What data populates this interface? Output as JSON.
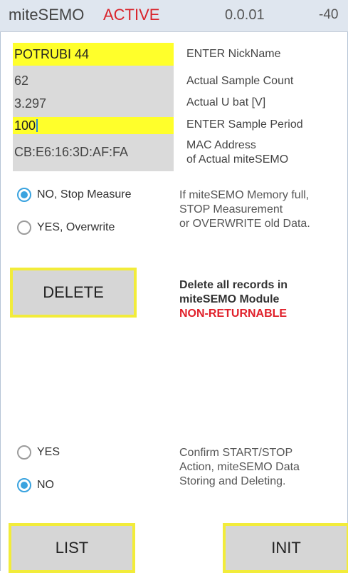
{
  "header": {
    "app_name": "miteSEMO",
    "status": "ACTIVE",
    "version": "0.0.01",
    "signal": "-40"
  },
  "fields": {
    "nickname": {
      "value": "POTRUBI 44",
      "label": "ENTER NickName"
    },
    "sample_count": {
      "value": "62",
      "label": "Actual Sample Count"
    },
    "u_bat": {
      "value": "3.297",
      "label": "Actual U bat [V]"
    },
    "sample_period": {
      "value": "100",
      "label": "ENTER Sample Period"
    },
    "mac": {
      "value": "CB:E6:16:3D:AF:FA",
      "label_line1": "MAC Address",
      "label_line2": "of Actual miteSEMO"
    }
  },
  "memory_full": {
    "options": [
      {
        "label": "NO, Stop Measure",
        "selected": true
      },
      {
        "label": "YES, Overwrite",
        "selected": false
      }
    ],
    "info_line1": "If miteSEMO Memory full,",
    "info_line2": "STOP Measurement",
    "info_line3": "or OVERWRITE old Data."
  },
  "delete": {
    "button_label": "DELETE",
    "info_line1": "Delete all records in",
    "info_line2": "miteSEMO Module",
    "warning": "NON-RETURNABLE"
  },
  "confirm": {
    "options": [
      {
        "label": "YES",
        "selected": false
      },
      {
        "label": "NO",
        "selected": true
      }
    ],
    "info_line1": "Confirm START/STOP",
    "info_line2": "Action, miteSEMO Data",
    "info_line3": "Storing and Deleting."
  },
  "bottom": {
    "list_label": "LIST",
    "init_label": "INIT"
  },
  "colors": {
    "accent": "#3aa3df",
    "status": "#d9222a",
    "input_highlight": "#ffff2b",
    "button_border": "#f2ec3a"
  }
}
